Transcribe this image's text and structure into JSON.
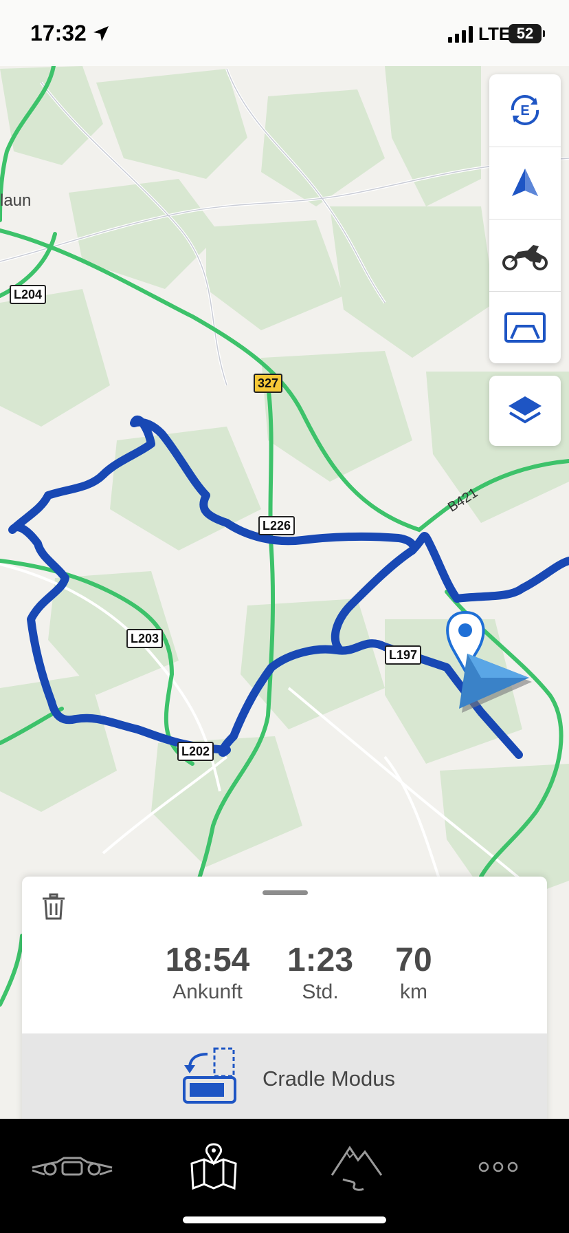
{
  "status_bar": {
    "time": "17:32",
    "network": "LTE",
    "battery": "52"
  },
  "map": {
    "place_labels": [
      "laun"
    ],
    "road_shields": [
      "L204",
      "327",
      "L226",
      "L203",
      "L197",
      "L202"
    ],
    "road_names": [
      "B421"
    ],
    "colors": {
      "route": "#1848b4",
      "major_road": "#3dc26a",
      "forest": "#d6e6cf",
      "land": "#f2f1ed"
    }
  },
  "map_controls": {
    "icons": [
      "eco-route-icon",
      "navigation-arrow-icon",
      "motorcycle-icon",
      "cradle-display-icon",
      "layers-icon"
    ]
  },
  "trip_summary": {
    "arrival_value": "18:54",
    "arrival_label": "Ankunft",
    "duration_value": "1:23",
    "duration_label": "Std.",
    "distance_value": "70",
    "distance_label": "km",
    "cradle_label": "Cradle Modus"
  },
  "tab_bar": {
    "icons": [
      "motorcycle-cockpit-icon",
      "route-map-icon",
      "mountain-trip-icon",
      "more-icon"
    ],
    "active": "route-map-icon"
  }
}
